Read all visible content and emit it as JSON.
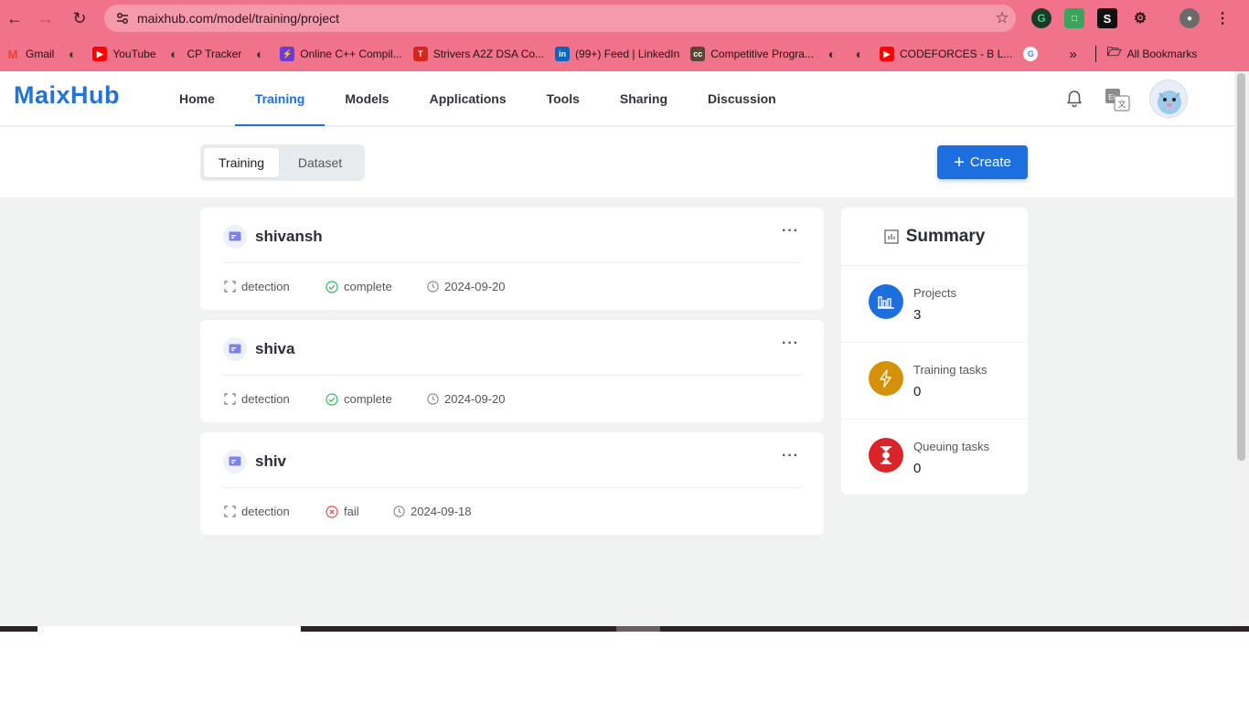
{
  "browser": {
    "url": "maixhub.com/model/training/project",
    "bookmarks": [
      {
        "label": "Gmail",
        "icon": "gmail-icon",
        "color": "#ea4335"
      },
      {
        "label": "",
        "icon": "globe-icon",
        "color": "#333333"
      },
      {
        "label": "YouTube",
        "icon": "youtube-icon",
        "color": "#ff0000"
      },
      {
        "label": "CP Tracker",
        "icon": "globe-icon",
        "color": "#333333"
      },
      {
        "label": "",
        "icon": "globe-icon",
        "color": "#333333"
      },
      {
        "label": "Online C++ Compil...",
        "icon": "bolt-icon",
        "color": "#6a3bd6"
      },
      {
        "label": "Strivers A2Z DSA Co...",
        "icon": "tuf-icon",
        "color": "#d7261f"
      },
      {
        "label": "(99+) Feed | LinkedIn",
        "icon": "linkedin-icon",
        "color": "#0a66c2"
      },
      {
        "label": "Competitive Progra...",
        "icon": "cc-icon",
        "color": "#5b4636"
      },
      {
        "label": "",
        "icon": "globe-icon",
        "color": "#333333"
      },
      {
        "label": "",
        "icon": "globe-icon",
        "color": "#333333"
      },
      {
        "label": "CODEFORCES - B L...",
        "icon": "youtube-icon",
        "color": "#ff0000"
      },
      {
        "label": "",
        "icon": "google-icon",
        "color": "#4285f4"
      }
    ],
    "all_bookmarks": "All Bookmarks"
  },
  "header": {
    "logo": "MaixHub",
    "nav": [
      "Home",
      "Training",
      "Models",
      "Applications",
      "Tools",
      "Sharing",
      "Discussion"
    ],
    "active_nav": "Training"
  },
  "subbar": {
    "tabs": [
      "Training",
      "Dataset"
    ],
    "active_tab": "Training",
    "create_label": "Create"
  },
  "projects": [
    {
      "name": "shivansh",
      "type": "detection",
      "status": "complete",
      "date": "2024-09-20"
    },
    {
      "name": "shiva",
      "type": "detection",
      "status": "complete",
      "date": "2024-09-20"
    },
    {
      "name": "shiv",
      "type": "detection",
      "status": "fail",
      "date": "2024-09-18"
    }
  ],
  "summary": {
    "title": "Summary",
    "rows": [
      {
        "label": "Projects",
        "value": "3",
        "icon": "bar-chart-icon",
        "color": "#1d6fe0"
      },
      {
        "label": "Training tasks",
        "value": "0",
        "icon": "lightning-icon",
        "color": "#d4920a"
      },
      {
        "label": "Queuing tasks",
        "value": "0",
        "icon": "hourglass-icon",
        "color": "#d9252a"
      }
    ]
  },
  "colors": {
    "accent": "#1d6fe0",
    "success": "#2fb85a",
    "fail": "#e04b4b",
    "browser_tint": "#f0738b"
  }
}
